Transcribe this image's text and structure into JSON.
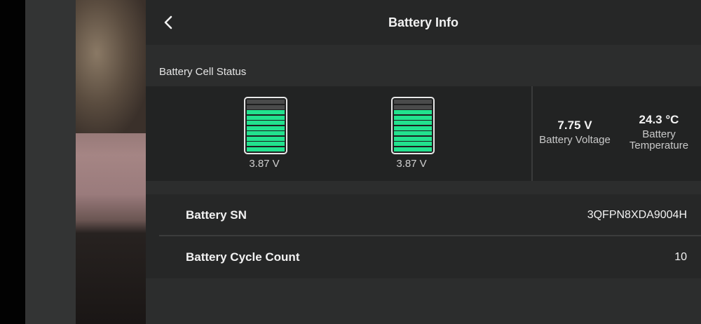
{
  "header": {
    "title": "Battery Info",
    "back_icon": "chevron-left-icon"
  },
  "cell_status": {
    "section_label": "Battery Cell Status",
    "cells": [
      {
        "voltage": "3.87 V",
        "level_fraction": 0.8
      },
      {
        "voltage": "3.87 V",
        "level_fraction": 0.8
      }
    ],
    "segment_count": 10,
    "colors": {
      "filled": "#22e28e",
      "empty": "#4a4b4b"
    }
  },
  "stats": {
    "voltage": {
      "value": "7.75 V",
      "label": "Battery Voltage"
    },
    "temperature": {
      "value": "24.3 °C",
      "label": "Battery Temperature"
    }
  },
  "details": [
    {
      "key": "Battery SN",
      "value": "3QFPN8XDA9004H"
    },
    {
      "key": "Battery Cycle Count",
      "value": "10"
    }
  ]
}
